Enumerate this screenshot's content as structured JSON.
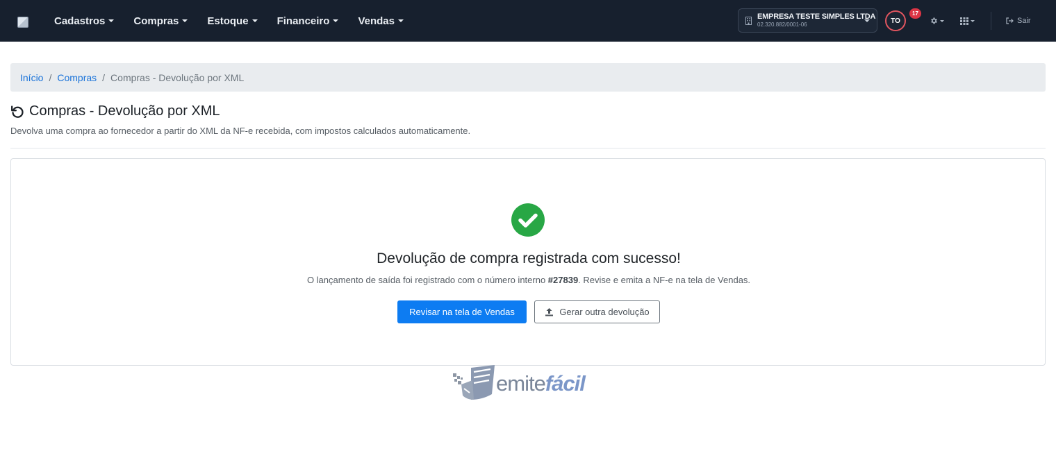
{
  "nav": {
    "items": [
      {
        "label": "Cadastros"
      },
      {
        "label": "Compras"
      },
      {
        "label": "Estoque"
      },
      {
        "label": "Financeiro"
      },
      {
        "label": "Vendas"
      }
    ],
    "company": {
      "name": "EMPRESA TESTE SIMPLES LTDA",
      "cnpj": "02.320.882/0001-06"
    },
    "user_initials": "TO",
    "notification_count": "17",
    "logout_label": "Sair"
  },
  "breadcrumb": {
    "items": [
      {
        "label": "Início"
      },
      {
        "label": "Compras"
      }
    ],
    "current": "Compras - Devolução por XML"
  },
  "page": {
    "title": "Compras - Devolução por XML",
    "subtitle": "Devolva uma compra ao fornecedor a partir do XML da NF-e recebida, com impostos calculados automaticamente."
  },
  "result": {
    "title": "Devolução de compra registrada com sucesso!",
    "text_before": "O lançamento de saída foi registrado com o número interno ",
    "number": "#27839",
    "text_after": ". Revise e emita a NF-e na tela de Vendas.",
    "primary_button": "Revisar na tela de Vendas",
    "secondary_button": "Gerar outra devolução"
  },
  "footer": {
    "logo_text_1": "emite",
    "logo_text_2": "fácil"
  },
  "colors": {
    "navbar": "#17202e",
    "primary": "#0d7cf2",
    "success": "#28a745",
    "badge": "#dc3545"
  }
}
